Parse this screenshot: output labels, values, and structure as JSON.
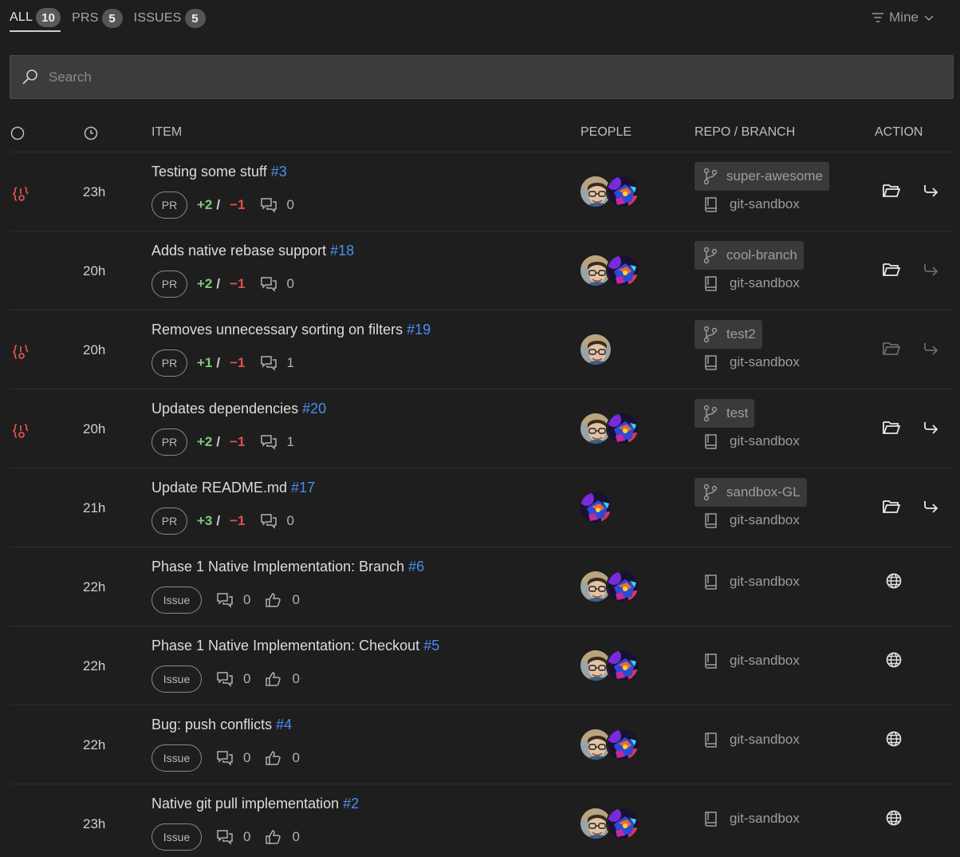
{
  "tabs": [
    {
      "label": "ALL",
      "count": "10",
      "active": true
    },
    {
      "label": "PRS",
      "count": "5",
      "active": false
    },
    {
      "label": "ISSUES",
      "count": "5",
      "active": false
    }
  ],
  "filter": {
    "label": "Mine"
  },
  "search": {
    "placeholder": "Search"
  },
  "columns": {
    "item": "ITEM",
    "people": "PEOPLE",
    "repo_branch": "REPO / BRANCH",
    "action": "ACTION"
  },
  "rows": [
    {
      "status_icon": "merge-conflict-icon",
      "time": "23h",
      "title": "Testing some stuff",
      "number": "#3",
      "kind": "PR",
      "additions": "+2",
      "slash": "/",
      "deletions": "−1",
      "comments": "0",
      "reactions": null,
      "avatars": [
        "person",
        "robot"
      ],
      "branch": "super-awesome",
      "repo": "git-sandbox",
      "actions": [
        "open-folder-icon",
        "switch-branch-icon"
      ],
      "actions_enabled": [
        true,
        true
      ]
    },
    {
      "status_icon": null,
      "time": "20h",
      "title": "Adds native rebase support",
      "number": "#18",
      "kind": "PR",
      "additions": "+2",
      "slash": "/",
      "deletions": "−1",
      "comments": "0",
      "reactions": null,
      "avatars": [
        "person",
        "robot"
      ],
      "branch": "cool-branch",
      "repo": "git-sandbox",
      "actions": [
        "open-folder-icon",
        "switch-branch-icon"
      ],
      "actions_enabled": [
        true,
        false
      ]
    },
    {
      "status_icon": "merge-conflict-icon",
      "time": "20h",
      "title": "Removes unnecessary sorting on filters",
      "number": "#19",
      "kind": "PR",
      "additions": "+1",
      "slash": "/",
      "deletions": "−1",
      "comments": "1",
      "reactions": null,
      "avatars": [
        "person"
      ],
      "branch": "test2",
      "repo": "git-sandbox",
      "actions": [
        "open-folder-icon",
        "switch-branch-icon"
      ],
      "actions_enabled": [
        false,
        false
      ]
    },
    {
      "status_icon": "merge-conflict-icon",
      "time": "20h",
      "title": "Updates dependencies",
      "number": "#20",
      "kind": "PR",
      "additions": "+2",
      "slash": "/",
      "deletions": "−1",
      "comments": "1",
      "reactions": null,
      "avatars": [
        "person",
        "robot"
      ],
      "branch": "test",
      "repo": "git-sandbox",
      "actions": [
        "open-folder-icon",
        "switch-branch-icon"
      ],
      "actions_enabled": [
        true,
        true
      ]
    },
    {
      "status_icon": null,
      "time": "21h",
      "title": "Update README.md",
      "number": "#17",
      "kind": "PR",
      "additions": "+3",
      "slash": "/",
      "deletions": "−1",
      "comments": "0",
      "reactions": null,
      "avatars": [
        "robot"
      ],
      "branch": "sandbox-GL",
      "repo": "git-sandbox",
      "actions": [
        "open-folder-icon",
        "switch-branch-icon"
      ],
      "actions_enabled": [
        true,
        true
      ]
    },
    {
      "status_icon": null,
      "time": "22h",
      "title": "Phase 1 Native Implementation: Branch",
      "number": "#6",
      "kind": "Issue",
      "comments": "0",
      "reactions": "0",
      "avatars": [
        "person",
        "robot"
      ],
      "branch": null,
      "repo": "git-sandbox",
      "actions": [
        "globe-icon"
      ],
      "actions_enabled": [
        true
      ]
    },
    {
      "status_icon": null,
      "time": "22h",
      "title": "Phase 1 Native Implementation: Checkout",
      "number": "#5",
      "kind": "Issue",
      "comments": "0",
      "reactions": "0",
      "avatars": [
        "person",
        "robot"
      ],
      "branch": null,
      "repo": "git-sandbox",
      "actions": [
        "globe-icon"
      ],
      "actions_enabled": [
        true
      ]
    },
    {
      "status_icon": null,
      "time": "22h",
      "title": "Bug: push conflicts",
      "number": "#4",
      "kind": "Issue",
      "comments": "0",
      "reactions": "0",
      "avatars": [
        "person",
        "robot"
      ],
      "branch": null,
      "repo": "git-sandbox",
      "actions": [
        "globe-icon"
      ],
      "actions_enabled": [
        true
      ]
    },
    {
      "status_icon": null,
      "time": "23h",
      "title": "Native git pull implementation",
      "number": "#2",
      "kind": "Issue",
      "comments": "0",
      "reactions": "0",
      "avatars": [
        "person",
        "robot"
      ],
      "branch": null,
      "repo": "git-sandbox",
      "actions": [
        "globe-icon"
      ],
      "actions_enabled": [
        true
      ]
    }
  ],
  "colors": {
    "background": "#1e1e1e",
    "link": "#4c8df0",
    "additions": "#7fc97f",
    "deletions": "#e05050",
    "conflict": "#e05050"
  }
}
